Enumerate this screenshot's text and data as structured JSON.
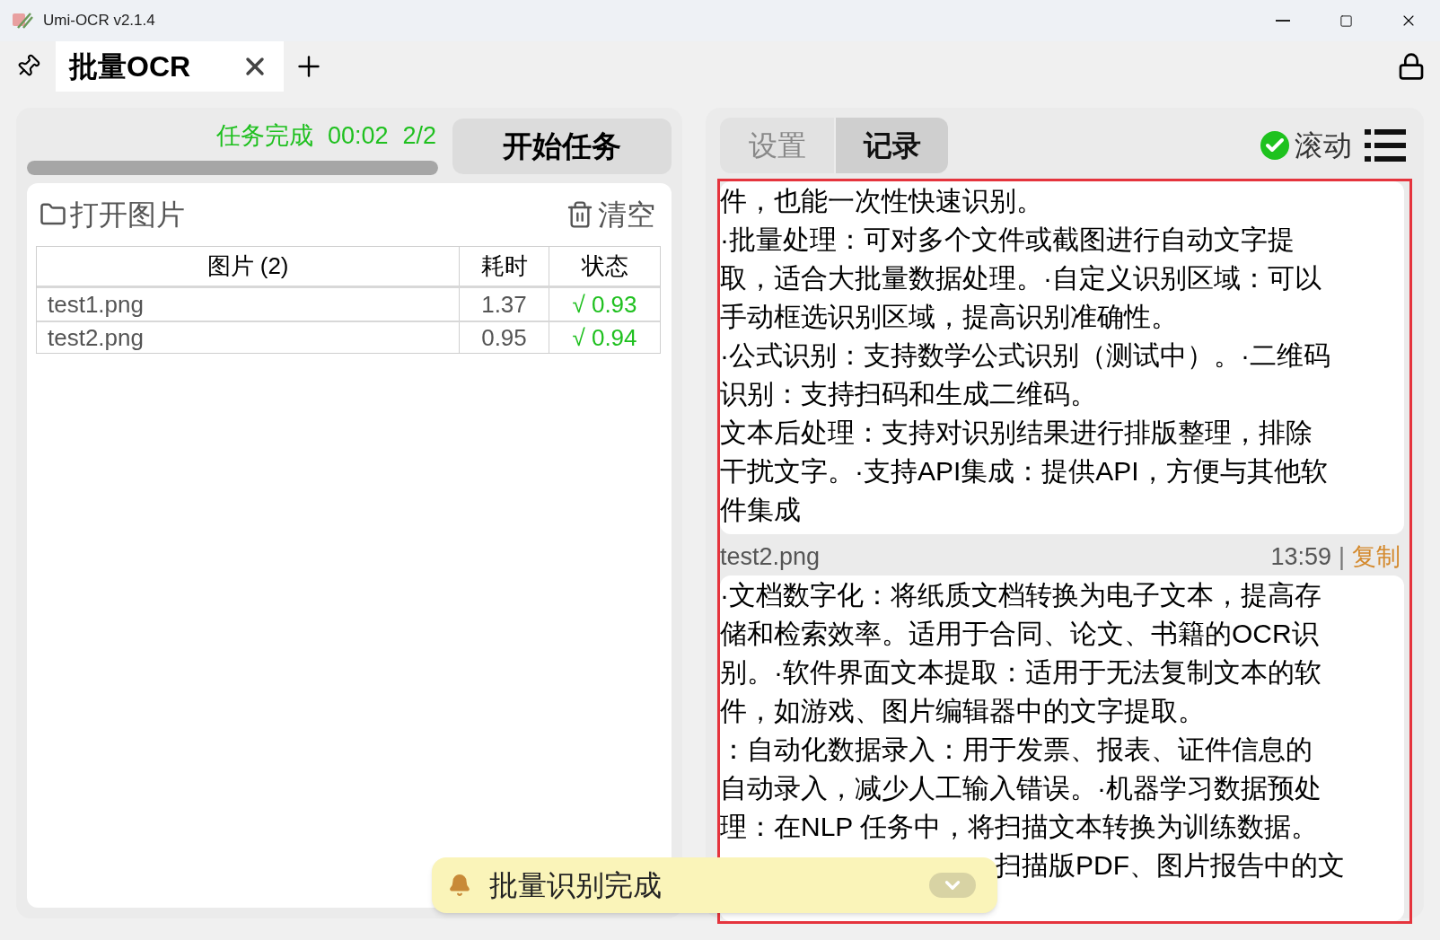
{
  "window": {
    "title": "Umi-OCR v2.1.4"
  },
  "tabs": [
    {
      "label": "批量OCR",
      "selected": true
    }
  ],
  "task": {
    "status": "任务完成",
    "elapsed": "00:02",
    "count": "2/2",
    "level": 1,
    "start_button": "开始任务"
  },
  "files": {
    "open_button": "打开图片",
    "clear_button": "清空",
    "columns": [
      "图片 (2)",
      "耗时",
      "状态"
    ],
    "rows": [
      {
        "name": "test1.png",
        "time": "1.37",
        "status": "√ 0.93"
      },
      {
        "name": "test2.png",
        "time": "0.95",
        "status": "√ 0.94"
      }
    ]
  },
  "panel_tabs": [
    {
      "label": "设置",
      "selected": false
    },
    {
      "label": "记录",
      "selected": true
    }
  ],
  "scroll_toggle": {
    "label": "滚动",
    "checked": true
  },
  "records": [
    {
      "lines": [
        "件，也能一次性快速识别。",
        "·批量处理：可对多个文件或截图进行自动文字提",
        "取，适合大批量数据处理。·自定义识别区域：可以",
        "手动框选识别区域，提高识别准确性。",
        "·公式识别：支持数学公式识别（测试中）。·二维码",
        "识别：支持扫码和生成二维码。",
        "文本后处理：支持对识别结果进行排版整理，排除",
        "干扰文字。·支持API集成：提供API，方便与其他软",
        "件集成"
      ]
    },
    {
      "file": "test2.png",
      "time": "13:59",
      "separator": "|",
      "copy": "复制",
      "lines": [
        "·文档数字化：将纸质文档转换为电子文本，提高存",
        "储和检索效率。适用于合同、论文、书籍的OCR识",
        "别。·软件界面文本提取：适用于无法复制文本的软",
        "件，如游戏、图片编辑器中的文字提取。",
        "：自动化数据录入：用于发票、报表、证件信息的",
        "自动录入，减少人工输入错误。·机器学习数据预处",
        "理：在NLP 任务中，将扫描文本转换为训练数据。"
      ],
      "covered_line": "扫描版PDF、图片报告中的文"
    }
  ],
  "notification": {
    "message": "批量识别完成"
  }
}
